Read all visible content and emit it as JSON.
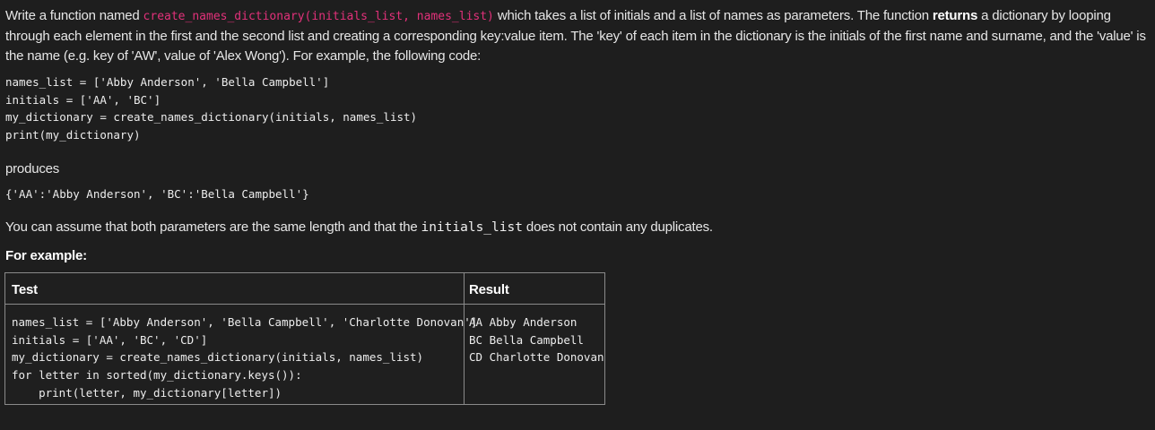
{
  "intro": {
    "text1": "Write a function named ",
    "func_signature": "create_names_dictionary(initials_list, names_list)",
    "text2": " which takes a list of initials and a list of names as parameters. The function ",
    "bold_returns": "returns",
    "text3": " a dictionary by looping through each element in the first and the second list and creating a corresponding key:value item. The 'key' of each item in the dictionary is the initials of the first name and surname, and the 'value' is the name (e.g. key of 'AW', value of 'Alex Wong'). For example, the following code:"
  },
  "example_code": [
    "names_list = ['Abby Anderson', 'Bella Campbell']",
    "initials = ['AA', 'BC']",
    "my_dictionary = create_names_dictionary(initials, names_list)",
    "print(my_dictionary)"
  ],
  "produces_label": "produces",
  "produces_output": "{'AA':'Abby Anderson', 'BC':'Bella Campbell'}",
  "assume": {
    "text1": "You can assume that both parameters are the same length and that the ",
    "code": "initials_list",
    "text2": " does not contain any duplicates."
  },
  "for_example_label": "For example:",
  "table": {
    "headers": [
      "Test",
      "Result"
    ],
    "test_code": [
      "names_list = ['Abby Anderson', 'Bella Campbell', 'Charlotte Donovan']",
      "initials = ['AA', 'BC', 'CD']",
      "my_dictionary = create_names_dictionary(initials, names_list)",
      "for letter in sorted(my_dictionary.keys()):",
      "    print(letter, my_dictionary[letter])"
    ],
    "result_lines": [
      "AA Abby Anderson",
      "BC Bella Campbell",
      "CD Charlotte Donovan"
    ]
  },
  "colors": {
    "background": "#1e1e1e",
    "text": "#e6e6e6",
    "function_code": "#e2317a",
    "table_border": "#8a8a8a"
  }
}
